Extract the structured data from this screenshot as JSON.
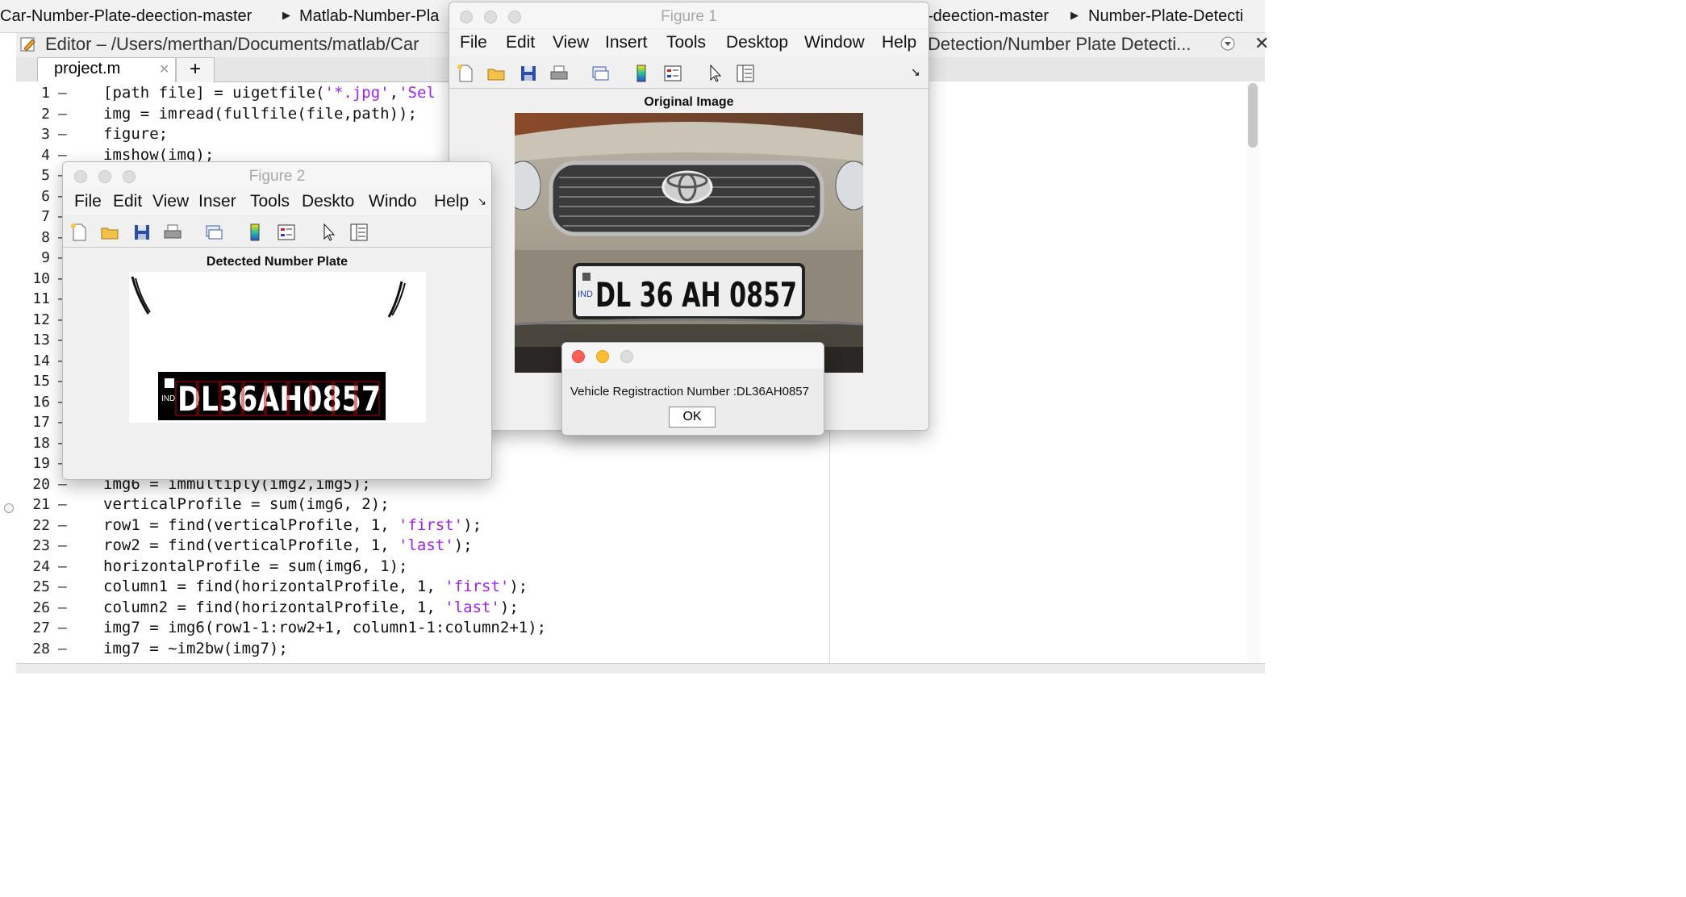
{
  "breadcrumb": {
    "left": [
      "Car-Number-Plate-deection-master",
      "Matlab-Number-Pla"
    ],
    "right": [
      "-deection-master",
      "Number-Plate-Detecti"
    ]
  },
  "editor": {
    "title": "Editor – /Users/merthan/Documents/matlab/Car",
    "title_right": "Detection/Number Plate Detecti...",
    "tab_label": "project.m",
    "tab_close": "✕",
    "tab_add": "+"
  },
  "code_lines": [
    {
      "n": "1",
      "text": "[path file] = uigetfile('*.jpg','Sel"
    },
    {
      "n": "2",
      "text": "img = imread(fullfile(file,path));"
    },
    {
      "n": "3",
      "text": "figure;"
    },
    {
      "n": "4",
      "text": "imshow(img);"
    },
    {
      "n": "5",
      "text": ""
    },
    {
      "n": "6",
      "text": ""
    },
    {
      "n": "7",
      "text": ""
    },
    {
      "n": "8",
      "text": ""
    },
    {
      "n": "9",
      "text": ""
    },
    {
      "n": "10",
      "text": ""
    },
    {
      "n": "11",
      "text": ""
    },
    {
      "n": "12",
      "text": ""
    },
    {
      "n": "13",
      "text": ""
    },
    {
      "n": "14",
      "text": ""
    },
    {
      "n": "15",
      "text": ""
    },
    {
      "n": "16",
      "text": ""
    },
    {
      "n": "17",
      "text": ""
    },
    {
      "n": "18",
      "text": ""
    },
    {
      "n": "19",
      "text": ""
    },
    {
      "n": "20",
      "text": "img6 = immultiply(img2,img5);"
    },
    {
      "n": "21",
      "text": "verticalProfile = sum(img6, 2);"
    },
    {
      "n": "22",
      "text": "row1 = find(verticalProfile, 1, 'first');"
    },
    {
      "n": "23",
      "text": "row2 = find(verticalProfile, 1, 'last');"
    },
    {
      "n": "24",
      "text": "horizontalProfile = sum(img6, 1);"
    },
    {
      "n": "25",
      "text": "column1 = find(horizontalProfile, 1, 'first');"
    },
    {
      "n": "26",
      "text": "column2 = find(horizontalProfile, 1, 'last');"
    },
    {
      "n": "27",
      "text": "img7 = img6(row1-1:row2+1, column1-1:column2+1);"
    },
    {
      "n": "28",
      "text": "img7 = ~im2bw(img7);"
    }
  ],
  "line_marker": "–",
  "figure1": {
    "title": "Figure 1",
    "menu": [
      "File",
      "Edit",
      "View",
      "Insert",
      "Tools",
      "Desktop",
      "Window",
      "Help"
    ],
    "axes_title": "Original Image",
    "plate_text": "DL 36 AH 0857",
    "plate_prefix": "IND"
  },
  "figure2": {
    "title": "Figure 2",
    "menu": [
      "File",
      "Edit",
      "View",
      "Inser",
      "Tools",
      "Deskto",
      "Windo",
      "Help"
    ],
    "axes_title": "Detected Number Plate",
    "plate_text": "DL36AH0857",
    "plate_prefix": "IND"
  },
  "dialog": {
    "message": "Vehicle Registraction Number :DL36AH0857",
    "ok_label": "OK"
  },
  "colors": {
    "string": "#a020f0",
    "close": "#ff5f57",
    "minimize": "#febc2e"
  }
}
